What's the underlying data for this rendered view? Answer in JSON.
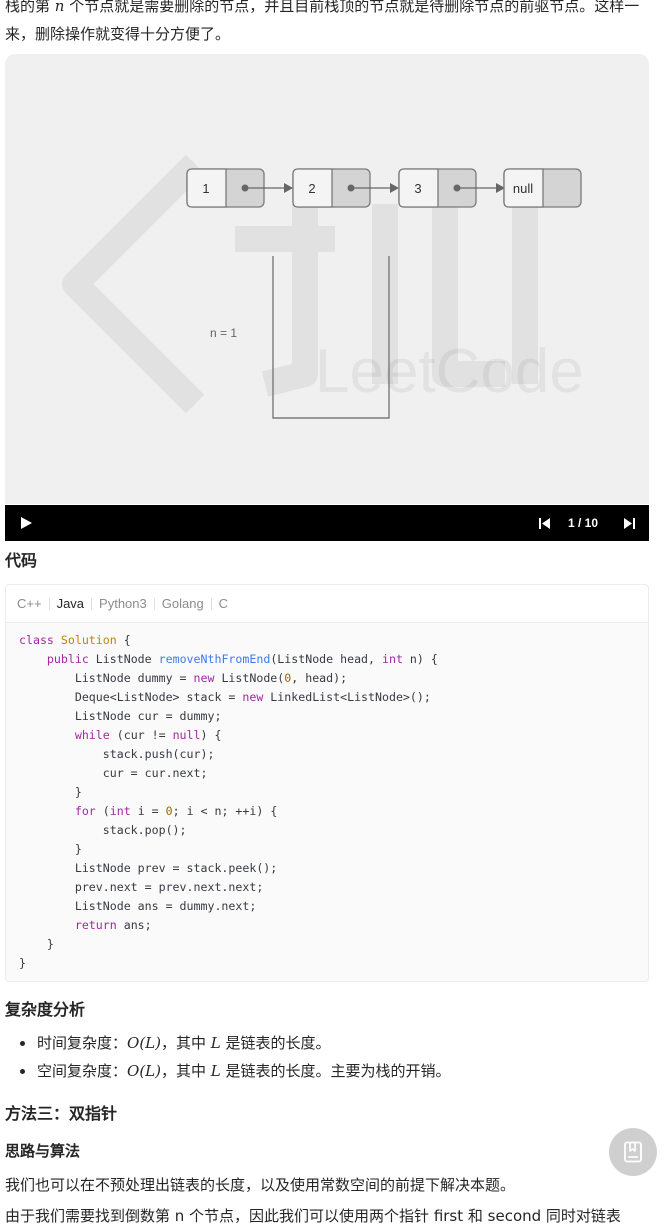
{
  "intro": {
    "text_a": "栈的第 ",
    "math_n": "n",
    "text_b": " 个节点就是需要删除的节点，并且目前栈顶的节点就是待删除节点的前驱节点。这样一来，删除操作就变得十分方便了。"
  },
  "animation": {
    "nodes": [
      "1",
      "2",
      "3",
      "null"
    ],
    "counter_label": "n = 1",
    "watermark_text": "LeetCode",
    "watermark_cn": "力扣",
    "step": "1 / 10"
  },
  "code_section": {
    "heading": "代码",
    "tabs": [
      "C++",
      "Java",
      "Python3",
      "Golang",
      "C"
    ],
    "active_tab": "Java"
  },
  "complexity": {
    "heading": "复杂度分析",
    "items": [
      {
        "label": "时间复杂度：",
        "math": "O(L)",
        "mid": "，其中 ",
        "var": "L",
        "rest": " 是链表的长度。"
      },
      {
        "label": "空间复杂度：",
        "math": "O(L)",
        "mid": "，其中 ",
        "var": "L",
        "rest": " 是链表的长度。主要为栈的开销。"
      }
    ]
  },
  "method3": {
    "heading": "方法三：双指针",
    "subheading": "思路与算法",
    "paragraph": "我们也可以在不预处理出链表的长度，以及使用常数空间的前提下解决本题。",
    "partial_next_line": "由于我们需要找到倒数第 n 个节点，因此我们可以使用两个指针 first 和 second 同时对链表"
  },
  "colors": {
    "node_fill": "#f4f4f4",
    "node_tail": "#d4d4d4",
    "node_stroke": "#7a7a7a",
    "keyword": "#a626a4",
    "type": "#c18401",
    "function": "#4078f2"
  },
  "icons": {
    "play": "play-icon",
    "prev": "skip-previous-icon",
    "next": "skip-next-icon",
    "fab": "notebook-icon"
  }
}
